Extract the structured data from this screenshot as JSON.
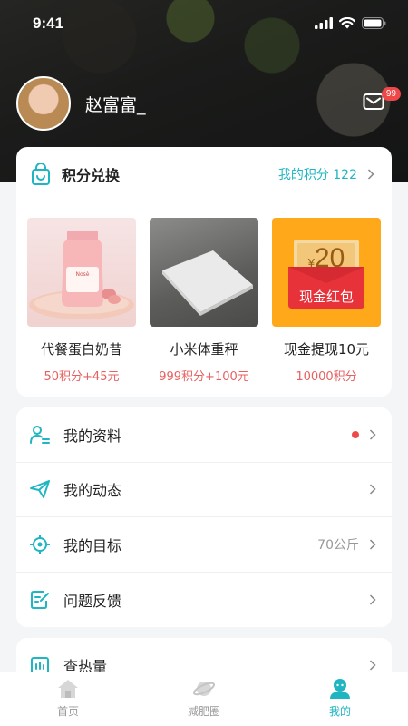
{
  "status": {
    "time": "9:41"
  },
  "profile": {
    "username": "赵富富_",
    "mail_badge": "99"
  },
  "exchange": {
    "title": "积分兑换",
    "points_text": "我的积分 122",
    "products": [
      {
        "name": "代餐蛋白奶昔",
        "price": "50积分+45元",
        "brand": "Nosè"
      },
      {
        "name": "小米体重秤",
        "price": "999积分+100元"
      },
      {
        "name": "现金提现10元",
        "price": "10000积分",
        "amount": "20",
        "currency": "¥",
        "envelope_label": "现金红包"
      }
    ]
  },
  "menu": [
    {
      "label": "我的资料",
      "extra": "",
      "icon": "user-profile-icon",
      "has_dot": true
    },
    {
      "label": "我的动态",
      "extra": "",
      "icon": "send-icon",
      "has_dot": false
    },
    {
      "label": "我的目标",
      "extra": "70公斤",
      "icon": "target-icon",
      "has_dot": false
    },
    {
      "label": "问题反馈",
      "extra": "",
      "icon": "feedback-icon",
      "has_dot": false
    }
  ],
  "calorie": {
    "label": "查热量",
    "icon": "chart-icon"
  },
  "tabs": [
    {
      "label": "首页",
      "icon": "home-icon",
      "active": false
    },
    {
      "label": "减肥圈",
      "icon": "planet-icon",
      "active": false
    },
    {
      "label": "我的",
      "icon": "profile-icon",
      "active": true
    }
  ],
  "colors": {
    "accent": "#1fb6c1",
    "price": "#e86060",
    "badge": "#f04848"
  }
}
